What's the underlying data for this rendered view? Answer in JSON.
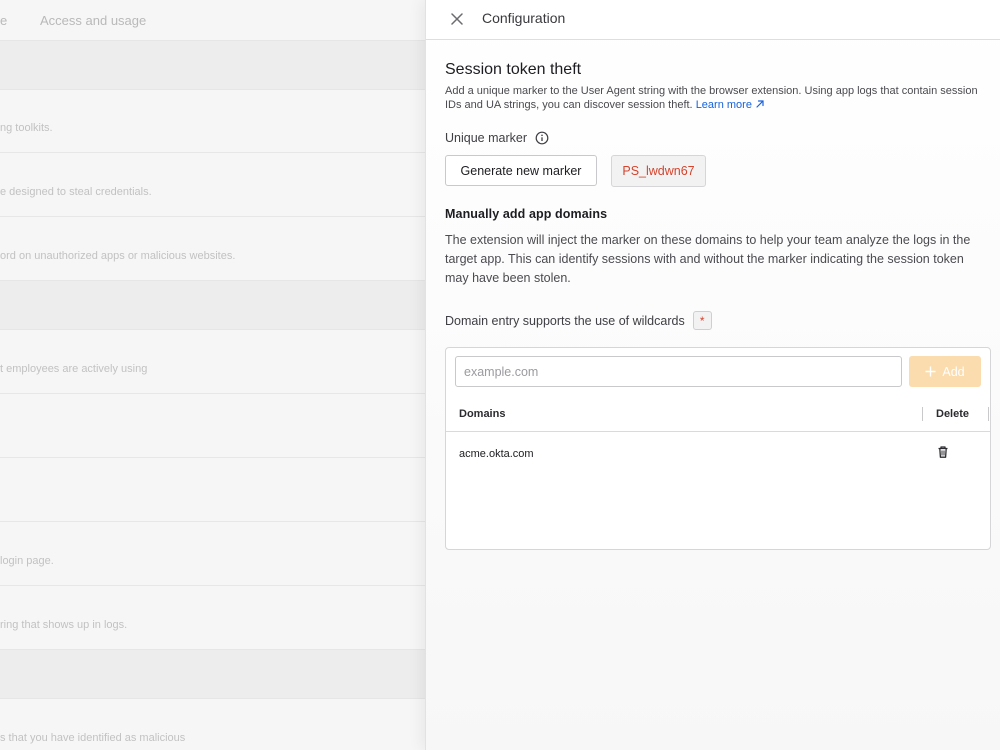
{
  "background": {
    "tabs": [
      {
        "label": "e"
      },
      {
        "label": "Access and usage"
      }
    ],
    "rows": [
      {
        "text": "ng toolkits."
      },
      {
        "text": "e designed to steal credentials."
      },
      {
        "text": "ord on unauthorized apps or malicious websites."
      },
      {
        "text": "t employees are actively using"
      },
      {
        "text": "login page."
      },
      {
        "text": "ring that shows up in logs."
      },
      {
        "text": "s that you have identified as malicious"
      }
    ]
  },
  "drawer": {
    "title": "Configuration",
    "section": {
      "title": "Session token theft",
      "description": "Add a unique marker to the User Agent string with the browser extension. Using app logs that contain session IDs and UA strings, you can discover session theft.",
      "learn_more": "Learn more"
    },
    "marker": {
      "label": "Unique marker",
      "generate_label": "Generate new marker",
      "value": "PS_lwdwn67"
    },
    "manual": {
      "title": "Manually add app domains",
      "description": "The extension will inject the marker on these domains to help your team analyze the logs in the target app. This can identify sessions with and without the marker indicating the session token may have been stolen."
    },
    "wildcards": {
      "label": "Domain entry supports the use of wildcards",
      "symbol": "*"
    },
    "domains": {
      "input_placeholder": "example.com",
      "input_value": "",
      "add_label": "Add",
      "columns": {
        "domains": "Domains",
        "delete": "Delete"
      },
      "rows": [
        {
          "domain": "acme.okta.com"
        }
      ]
    },
    "colors": {
      "accent": "#1662dd",
      "marker_text": "#d4442c",
      "add_button": "#fbdcae"
    }
  }
}
